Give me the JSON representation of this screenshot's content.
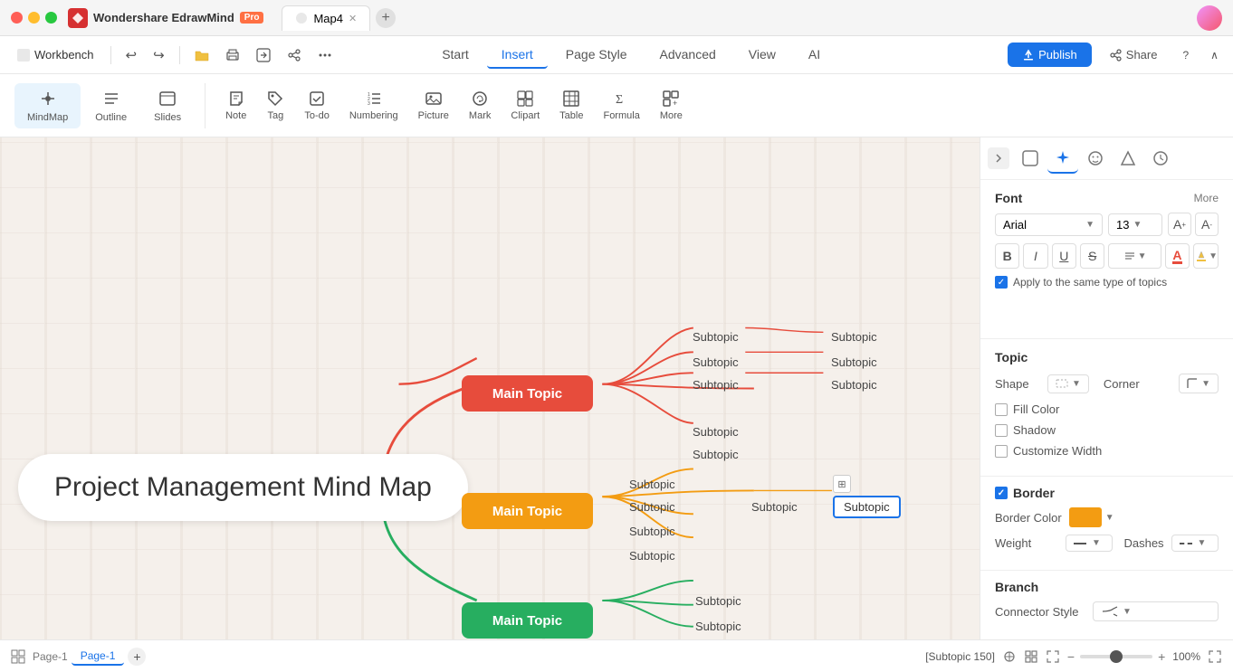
{
  "app": {
    "title": "Wondershare EdrawMind",
    "badge": "Pro",
    "tab_name": "Map4"
  },
  "titlebar": {
    "workbench_label": "Workbench"
  },
  "menubar": {
    "nav_tabs": [
      "Start",
      "Insert",
      "Page Style",
      "Advanced",
      "View",
      "AI"
    ],
    "active_tab": "Insert",
    "publish_label": "Publish",
    "share_label": "Share"
  },
  "toolbar": {
    "view_items": [
      {
        "icon": "⊹",
        "label": "MindMap"
      },
      {
        "icon": "☰",
        "label": "Outline"
      },
      {
        "icon": "⬜",
        "label": "Slides"
      }
    ],
    "insert_items": [
      {
        "icon": "✏️",
        "label": "Note"
      },
      {
        "icon": "🏷",
        "label": "Tag"
      },
      {
        "icon": "☑",
        "label": "To-do"
      },
      {
        "icon": "≡",
        "label": "Numbering"
      },
      {
        "icon": "🖼",
        "label": "Picture"
      },
      {
        "icon": "😊",
        "label": "Mark"
      },
      {
        "icon": "📋",
        "label": "Clipart"
      },
      {
        "icon": "▦",
        "label": "Table"
      },
      {
        "icon": "Σ",
        "label": "Formula"
      },
      {
        "icon": "⋯",
        "label": "More"
      }
    ]
  },
  "canvas": {
    "map_title": "Project Management Mind Map",
    "topics": [
      {
        "id": "t1",
        "label": "Main Topic",
        "color": "#e74c3c"
      },
      {
        "id": "t2",
        "label": "Main Topic",
        "color": "#f39c12"
      },
      {
        "id": "t3",
        "label": "Main Topic",
        "color": "#27ae60"
      }
    ],
    "subtopics_t1": [
      "Subtopic",
      "Subtopic",
      "Subtopic",
      "Subtopic",
      "Subtopic"
    ],
    "subtopics_t2": [
      "Subtopic",
      "Subtopic",
      "Subtopic",
      "Subtopic",
      "Subtopic"
    ],
    "subtopics_t3": [
      "Subtopic",
      "Subtopic",
      "Subtopic"
    ],
    "selected_subtopic": "Subtopic",
    "selected_subtopic_id": "Subtopic 150"
  },
  "right_panel": {
    "font": {
      "section_title": "Font",
      "more_label": "More",
      "font_name": "Arial",
      "font_size": "13",
      "bold": "B",
      "italic": "I",
      "underline": "U",
      "strikethrough": "S",
      "apply_label": "Apply to the same type of topics"
    },
    "topic": {
      "section_title": "Topic",
      "shape_label": "Shape",
      "corner_label": "Corner",
      "fill_color_label": "Fill Color",
      "shadow_label": "Shadow",
      "customize_width_label": "Customize Width"
    },
    "border": {
      "section_title": "Border",
      "border_color_label": "Border Color",
      "weight_label": "Weight",
      "dashes_label": "Dashes"
    },
    "branch": {
      "section_title": "Branch",
      "connector_style_label": "Connector Style"
    }
  },
  "statusbar": {
    "page_label": "Page-1",
    "selected_item": "[Subtopic 150]",
    "zoom_value": "100%"
  }
}
